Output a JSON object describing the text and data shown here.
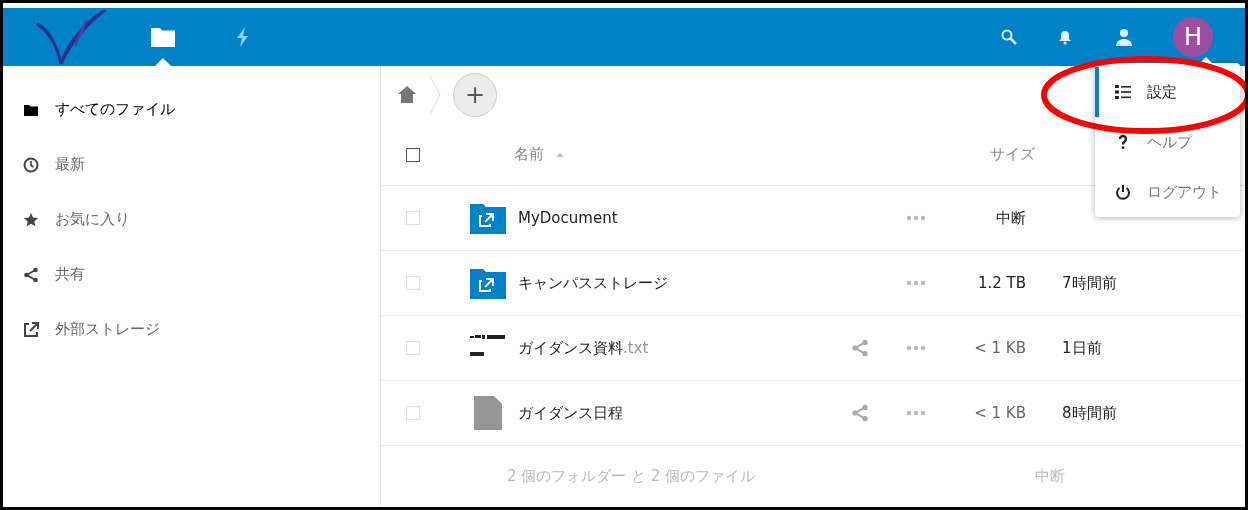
{
  "header": {
    "apps": [
      {
        "kind": "files",
        "selected": true
      },
      {
        "kind": "activity",
        "selected": false
      }
    ],
    "avatar": "H"
  },
  "sidebar": {
    "items": [
      {
        "kind": "folder",
        "label": "すべてのファイル",
        "selected": true
      },
      {
        "kind": "clock",
        "label": "最新",
        "selected": false
      },
      {
        "kind": "star",
        "label": "お気に入り",
        "selected": false
      },
      {
        "kind": "share",
        "label": "共有",
        "selected": false
      },
      {
        "kind": "external",
        "label": "外部ストレージ",
        "selected": false
      }
    ]
  },
  "breadcrumb": {
    "new_button": "+"
  },
  "table": {
    "select_all_checked": false,
    "columns": [
      "名前",
      "サイズ"
    ],
    "rows": [
      {
        "kind": "external-folder",
        "name": "MyDocument",
        "ext": "",
        "shared": false,
        "size": "中断",
        "checked": false
      },
      {
        "kind": "external-folder",
        "name": "キャンパスストレージ",
        "ext": "",
        "shared": false,
        "size": "1.2 TB",
        "modified": "7時間前",
        "checked": false
      },
      {
        "kind": "text-file",
        "name": "ガイダンス資料",
        "ext": ".txt",
        "shared": true,
        "size": "< 1 KB",
        "modified": "1日前",
        "checked": false
      },
      {
        "kind": "file",
        "name": "ガイダンス日程",
        "ext": "",
        "shared": true,
        "size": "< 1 KB",
        "modified": "8時間前",
        "checked": false
      }
    ],
    "summary": {
      "text": "2 個のフォルダー と 2 個のファイル",
      "size": "中断"
    }
  },
  "menu": {
    "items": [
      {
        "kind": "settings",
        "label": "設定",
        "selected": true
      },
      {
        "kind": "help",
        "label": "ヘルプ",
        "selected": false
      },
      {
        "kind": "logout",
        "label": "ログアウト",
        "selected": false
      }
    ]
  }
}
